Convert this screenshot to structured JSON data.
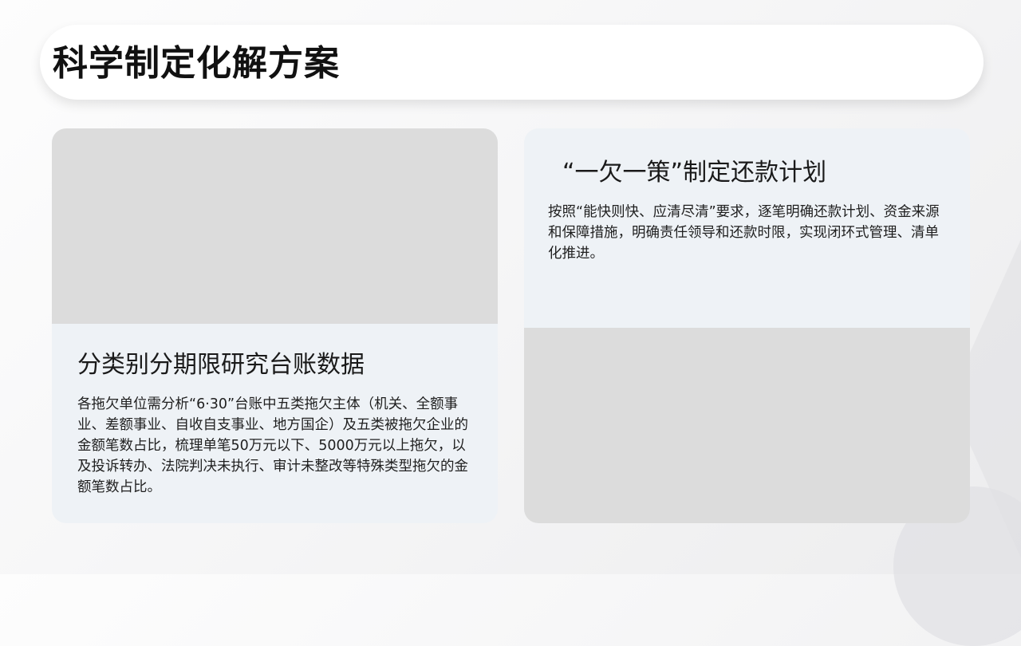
{
  "page": {
    "title": "科学制定化解方案"
  },
  "cards": {
    "left": {
      "heading": "分类别分期限研究台账数据",
      "body": "各拖欠单位需分析“6·30”台账中五类拖欠主体（机关、全额事业、差额事业、自收自支事业、地方国企）及五类被拖欠企业的金额笔数占比，梳理单笔50万元以下、5000万元以上拖欠，以及投诉转办、法院判决未执行、审计未整改等特殊类型拖欠的金额笔数占比。"
    },
    "right": {
      "heading": "“一欠一策”制定还款计划",
      "body": "按照“能快则快、应清尽清”要求，逐笔明确还款计划、资金来源和保障措施，明确责任领导和还款时限，实现闭环式管理、清单化推进。"
    }
  },
  "colors": {
    "card_background": "#eef2f6",
    "image_placeholder": "#dcdcdc",
    "title_bar": "#ffffff",
    "text": "#1a1a1a"
  }
}
